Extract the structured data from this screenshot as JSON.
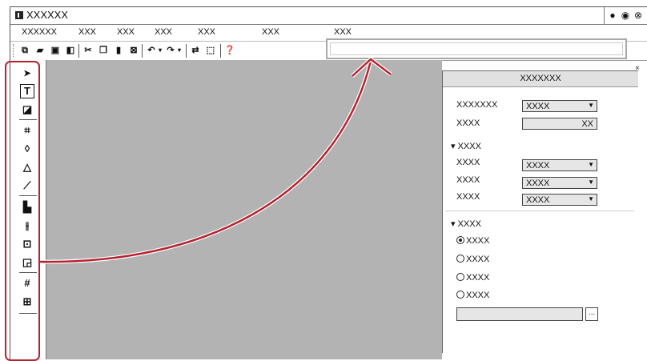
{
  "window": {
    "title": "XXXXXX",
    "controls": [
      "●",
      "◉",
      "⊗"
    ]
  },
  "menu": [
    "XXXXXX",
    "XXX",
    "XXX",
    "XXX",
    "XXX",
    "XXX",
    "XXX"
  ],
  "toolbar": {
    "buttons": [
      "new-icon",
      "open-icon",
      "save-icon",
      "save-as-icon",
      "cut-icon",
      "copy-icon",
      "paste-icon",
      "delete-icon",
      "undo-icon",
      "redo-icon",
      "replace-icon",
      "select-all-icon",
      "help-icon"
    ]
  },
  "tools": [
    "select-icon",
    "text-icon",
    "image-icon",
    "crop-icon",
    "shape-icon",
    "triangle-icon",
    "line-icon",
    "align-icon",
    "distribute-icon",
    "frame-icon",
    "layer-icon",
    "grid-icon",
    "table-icon"
  ],
  "panel": {
    "title": "XXXXXXX",
    "row1": {
      "label": "XXXXXXX",
      "value": "XXXX"
    },
    "row2": {
      "label": "XXXX",
      "value": "XX"
    },
    "section1": {
      "title": "XXXX",
      "rows": [
        {
          "label": "XXXX",
          "value": "XXXX"
        },
        {
          "label": "XXXX",
          "value": "XXXX"
        },
        {
          "label": "XXXX",
          "value": "XXXX"
        }
      ]
    },
    "section2": {
      "title": "XXXX",
      "options": [
        "XXXX",
        "XXXX",
        "XXXX",
        "XXXX"
      ],
      "selected_index": 0
    },
    "browse_label": "..."
  },
  "colors": {
    "highlight": "#b52330",
    "canvas": "#b3b3b3",
    "panel_header": "#e1e1e1"
  }
}
